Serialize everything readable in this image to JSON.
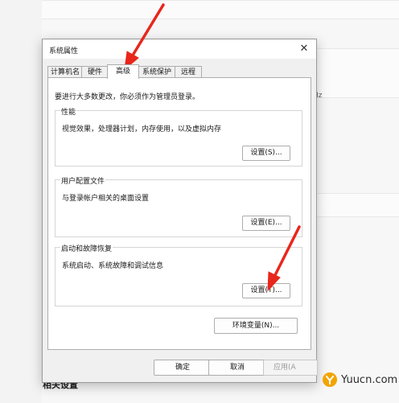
{
  "dialog": {
    "title": "系统属性",
    "close_glyph": "✕",
    "tabs": [
      {
        "label": "计算机名"
      },
      {
        "label": "硬件"
      },
      {
        "label": "高级"
      },
      {
        "label": "系统保护"
      },
      {
        "label": "远程"
      }
    ],
    "active_tab": "高级",
    "admin_note": "要进行大多数更改，你必须作为管理员登录。",
    "groups": {
      "performance": {
        "title": "性能",
        "description": "视觉效果，处理器计划，内存使用，以及虚拟内存",
        "button": "设置(S)..."
      },
      "user_profiles": {
        "title": "用户配置文件",
        "description": "与登录帐户相关的桌面设置",
        "button": "设置(E)..."
      },
      "startup_recovery": {
        "title": "启动和故障恢复",
        "description": "系统启动、系统故障和调试信息",
        "button": "设置(T)..."
      }
    },
    "env_button": "环境变量(N)...",
    "footer": {
      "ok": "确定",
      "cancel": "取消",
      "apply": "应用(A"
    }
  },
  "background": {
    "hz_text": "Hz",
    "related_settings": "相关设置"
  },
  "watermark": {
    "text": "Yuucn.com",
    "logo": "yuucn-logo"
  },
  "annotations": {
    "arrow_color": "#e8261c"
  }
}
